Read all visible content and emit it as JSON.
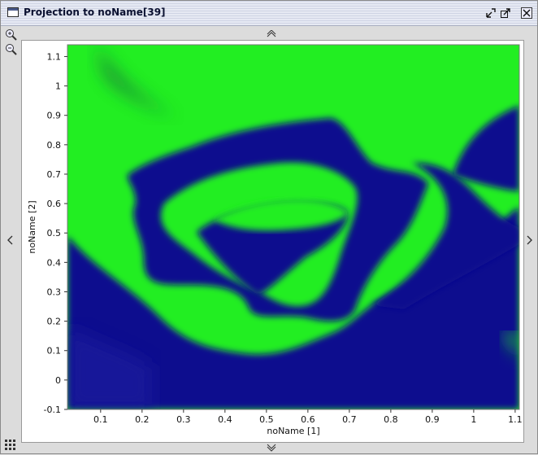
{
  "window": {
    "title": "Projection to noName[39]",
    "icons": [
      "window-icon",
      "minimize-icon",
      "maximize-icon",
      "close-icon"
    ]
  },
  "toolbar": {
    "tools": [
      "zoom-in-icon",
      "zoom-out-icon"
    ]
  },
  "navigation": {
    "arrows": [
      "scroll-up-arrow",
      "scroll-down-arrow",
      "scroll-left-arrow",
      "scroll-right-arrow"
    ]
  },
  "chart_data": {
    "type": "heatmap",
    "xlabel": "noName [1]",
    "ylabel": "noName [2]",
    "xlim": [
      0.02,
      1.11
    ],
    "ylim": [
      -0.1,
      1.14
    ],
    "x_ticks": [
      "0.1",
      "0.2",
      "0.3",
      "0.4",
      "0.5",
      "0.6",
      "0.7",
      "0.8",
      "0.9",
      "1",
      "1.1"
    ],
    "y_ticks": [
      "-0.1",
      "0",
      "0.1",
      "0.2",
      "0.3",
      "0.4",
      "0.5",
      "0.6",
      "0.7",
      "0.8",
      "0.9",
      "1",
      "1.1"
    ],
    "colors": {
      "high": "#22ee22",
      "low": "#0b0b8e",
      "mid_shade": "#1a7a3a"
    },
    "description_regions": [
      "green",
      "blue"
    ]
  }
}
